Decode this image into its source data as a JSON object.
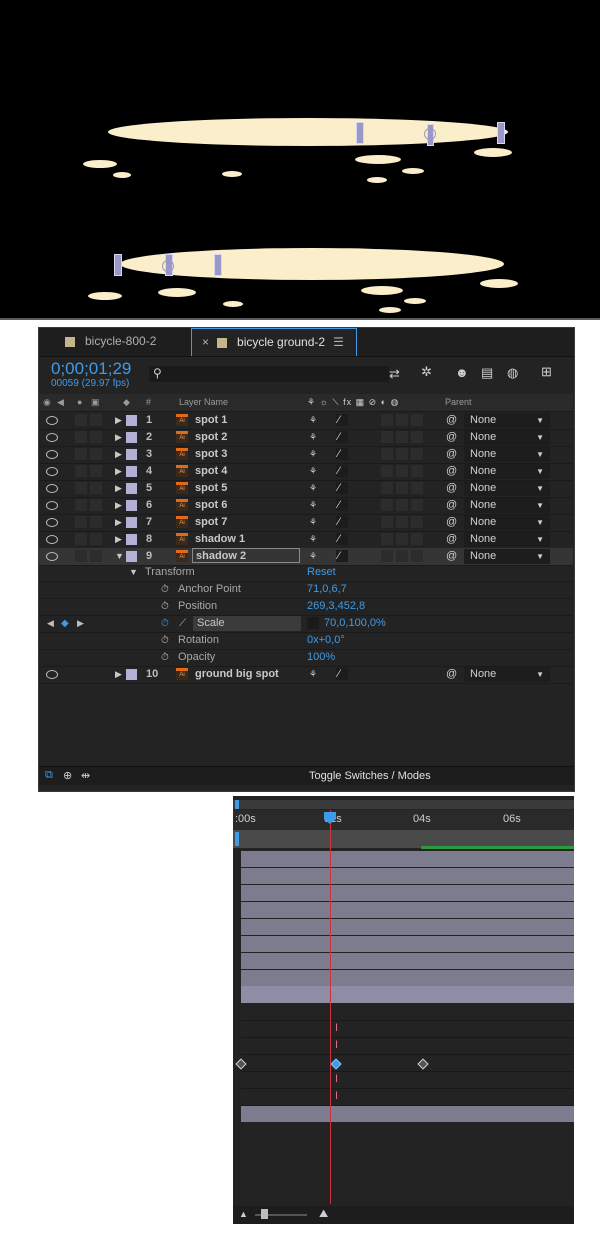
{
  "tabs": [
    {
      "label": "bicycle-800-2",
      "close": ""
    },
    {
      "label": "bicycle ground-2",
      "close": "×",
      "menu": "☰"
    }
  ],
  "timecode": "0;00;01;29",
  "frame_info": "00059 (29.97 fps)",
  "search": {
    "icon": "search-icon"
  },
  "columns": {
    "hash": "#",
    "layer_name": "Layer Name",
    "switch_icons": "⚘ ☼ ⟍ fx ▦ ⊘ ◐ ◍",
    "parent": "Parent"
  },
  "layers": [
    {
      "num": "1",
      "name": "spot 1",
      "parent": "None"
    },
    {
      "num": "2",
      "name": "spot 2",
      "parent": "None"
    },
    {
      "num": "3",
      "name": "spot 3",
      "parent": "None"
    },
    {
      "num": "4",
      "name": "spot 4",
      "parent": "None"
    },
    {
      "num": "5",
      "name": "spot 5",
      "parent": "None"
    },
    {
      "num": "6",
      "name": "spot 6",
      "parent": "None"
    },
    {
      "num": "7",
      "name": "spot 7",
      "parent": "None"
    },
    {
      "num": "8",
      "name": "shadow 1",
      "parent": "None"
    },
    {
      "num": "9",
      "name": "shadow 2",
      "parent": "None"
    }
  ],
  "transform": {
    "label": "Transform",
    "reset": "Reset",
    "props": [
      {
        "name": "Anchor Point",
        "value": "71,0,6,7"
      },
      {
        "name": "Position",
        "value": "269,3,452,8"
      },
      {
        "name": "Scale",
        "value": "70,0,100,0%"
      },
      {
        "name": "Rotation",
        "value": "0x+0,0°"
      },
      {
        "name": "Opacity",
        "value": "100%"
      }
    ]
  },
  "layer10": {
    "num": "10",
    "name": "ground big spot",
    "parent": "None"
  },
  "footer": {
    "toggle": "Toggle Switches / Modes"
  },
  "ruler": {
    "t0": ":00s",
    "t1": "02s",
    "t2": "04s",
    "t3": "06s"
  },
  "colors": {
    "accent": "#3f9be8",
    "label": "#b3b0d6",
    "playhead": "#d0303a",
    "workarea": "#2a9a3a"
  }
}
